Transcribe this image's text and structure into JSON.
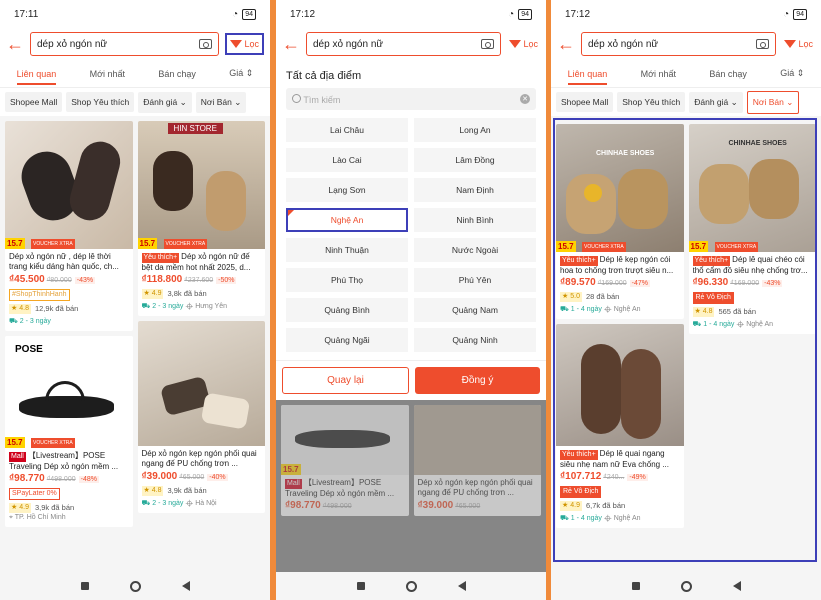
{
  "status": {
    "p1_time": "17:11",
    "p2_time": "17:12",
    "p3_time": "17:12",
    "battery": "94"
  },
  "search": {
    "query": "dép xỏ ngón nữ",
    "filter_label": "Lọc"
  },
  "tabs": [
    "Liên quan",
    "Mới nhất",
    "Bán chạy",
    "Giá"
  ],
  "chips": [
    "Shopee Mall",
    "Shop Yêu thích",
    "Đánh giá",
    "Nơi Bán"
  ],
  "badges": {
    "d157": "15.7",
    "voucher": "VOUCHER XTRA"
  },
  "p1": {
    "c1": {
      "title": "Dép xỏ ngón nữ , dép lê thời trang kiểu dáng hàn quốc, ch...",
      "price": "₫45.500",
      "old": "₫80.000",
      "disc": "-43%",
      "shop": "#ShopThinhHanh",
      "rating": "4.8",
      "sold": "12,9k đã bán",
      "ship": "2 - 3 ngày"
    },
    "c2": {
      "tag": "Yêu thích+",
      "title": "Dép xỏ ngón nữ đế bệt da mềm hot nhất 2025, d...",
      "price": "₫118.800",
      "old": "₫237.600",
      "disc": "-50%",
      "rating": "4.9",
      "sold": "3,8k đã bán",
      "ship": "2 - 3 ngày",
      "loc": "Hưng Yên",
      "store": "HIN STORE"
    },
    "c3": {
      "brand": "POSE",
      "mall": "Mall",
      "title": "【Livestream】POSE Traveling Dép xỏ ngón mềm ...",
      "price": "₫98.770",
      "old": "₫498.000",
      "disc": "-48%",
      "paylater": "SPayLater 0%",
      "rating": "4.9",
      "sold": "3,9k đã bán",
      "loc": "TP. Hồ Chí Minh"
    },
    "c4": {
      "title": "Dép xỏ ngón kẹp ngón phối quai ngang đế PU chống trơn ...",
      "price": "₫39.000",
      "old": "₫65.000",
      "disc": "-40%",
      "rating": "4.8",
      "sold": "3,9k đã bán",
      "ship": "2 - 3 ngày",
      "loc": "Hà Nội"
    }
  },
  "p2": {
    "heading": "Tất cả địa điểm",
    "placeholder": "Tìm kiếm",
    "locations": [
      "Lai Châu",
      "Long An",
      "Lào Cai",
      "Lâm Đồng",
      "Lạng Sơn",
      "Nam Định",
      "Nghệ An",
      "Ninh Bình",
      "Ninh Thuận",
      "Nước Ngoài",
      "Phú Thọ",
      "Phú Yên",
      "Quảng Bình",
      "Quảng Nam",
      "Quảng Ngãi",
      "Quảng Ninh"
    ],
    "selected": "Nghệ An",
    "reset": "Quay lại",
    "confirm": "Đồng ý"
  },
  "p3": {
    "c1": {
      "store": "CHINHAE SHOES",
      "tag": "Yêu thích+",
      "title": "Dép lê kẹp ngón cói hoa to chống trơn trượt siêu n...",
      "price": "₫89.570",
      "old": "₫169.000",
      "disc": "-47%",
      "rating": "5.0",
      "sold": "28 đã bán",
      "ship": "1 - 4 ngày",
      "loc": "Nghệ An"
    },
    "c2": {
      "store": "CHINHAE SHOES",
      "tag": "Yêu thích+",
      "title": "Dép lê quai chéo cói thổ cẩm đồ siêu nhẹ chống trơ...",
      "price": "₫96.330",
      "old": "₫169.000",
      "disc": "-43%",
      "re": "Rẻ Vô Địch",
      "rating": "4.8",
      "sold": "565 đã bán",
      "ship": "1 - 4 ngày",
      "loc": "Nghệ An"
    },
    "c3": {
      "tag": "Yêu thích+",
      "title": "Dép lê quai ngang siêu nhẹ nam nữ Eva chống ...",
      "price": "₫107.712",
      "old": "₫240...",
      "disc": "-49%",
      "re": "Rẻ Vô Địch",
      "rating": "4.9",
      "sold": "6,7k đã bán",
      "ship": "1 - 4 ngày",
      "loc": "Nghệ An"
    }
  }
}
